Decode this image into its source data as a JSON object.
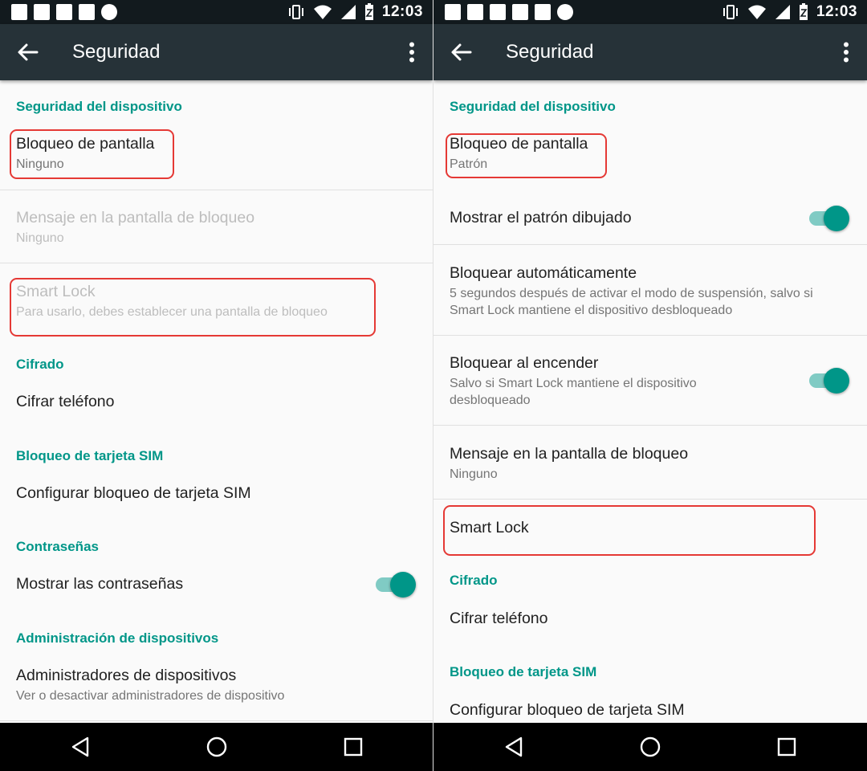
{
  "status_bar": {
    "time": "12:03"
  },
  "left": {
    "appbar": {
      "title": "Seguridad"
    },
    "sections": {
      "device_security": "Seguridad del dispositivo",
      "encryption": "Cifrado",
      "sim_lock": "Bloqueo de tarjeta SIM",
      "passwords": "Contraseñas",
      "device_admin": "Administración de dispositivos"
    },
    "items": {
      "screen_lock": {
        "title": "Bloqueo de pantalla",
        "subtitle": "Ninguno"
      },
      "lockscreen_message": {
        "title": "Mensaje en la pantalla de bloqueo",
        "subtitle": "Ninguno"
      },
      "smart_lock": {
        "title": "Smart Lock",
        "subtitle": "Para usarlo, debes establecer una pantalla de bloqueo"
      },
      "encrypt_phone": {
        "title": "Cifrar teléfono"
      },
      "sim_config": {
        "title": "Configurar bloqueo de tarjeta SIM"
      },
      "show_passwords": {
        "title": "Mostrar las contraseñas",
        "toggle": true
      },
      "device_admins": {
        "title": "Administradores de dispositivos",
        "subtitle": "Ver o desactivar administradores de dispositivo"
      }
    }
  },
  "right": {
    "appbar": {
      "title": "Seguridad"
    },
    "sections": {
      "device_security": "Seguridad del dispositivo",
      "encryption": "Cifrado",
      "sim_lock": "Bloqueo de tarjeta SIM"
    },
    "items": {
      "screen_lock": {
        "title": "Bloqueo de pantalla",
        "subtitle": "Patrón"
      },
      "show_pattern": {
        "title": "Mostrar el patrón dibujado",
        "toggle": true
      },
      "auto_lock": {
        "title": "Bloquear automáticamente",
        "subtitle": "5 segundos después de activar el modo de suspensión, salvo si Smart Lock mantiene el dispositivo desbloqueado"
      },
      "power_lock": {
        "title": "Bloquear al encender",
        "subtitle": "Salvo si Smart Lock mantiene el dispositivo desbloqueado",
        "toggle": true
      },
      "lockscreen_message": {
        "title": "Mensaje en la pantalla de bloqueo",
        "subtitle": "Ninguno"
      },
      "smart_lock": {
        "title": "Smart Lock"
      },
      "encrypt_phone": {
        "title": "Cifrar teléfono"
      },
      "sim_config": {
        "title": "Configurar bloqueo de tarjeta SIM"
      }
    }
  },
  "colors": {
    "accent": "#009688",
    "appbar": "#263238",
    "status": "#121a1e",
    "highlight": "#e53935"
  }
}
